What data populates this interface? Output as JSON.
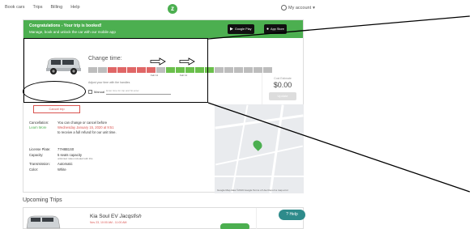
{
  "nav": {
    "links": [
      "Book cars",
      "Trips",
      "Billing",
      "Help"
    ],
    "account_label": "My account"
  },
  "banner": {
    "title": "Congratulations - Your trip is booked!",
    "subtitle": "Manage, book and unlock the car with our mobile app",
    "google_play": "Google Play",
    "app_store": "App Store"
  },
  "trip": {
    "change_time_title": "Change time:",
    "time_start": "Feb 11",
    "time_end": "Feb 11",
    "timeline_note": "Adjust your time with the handles",
    "manual_label": "Manual",
    "manual_placeholder": "Enter time for trip and hit enter",
    "cancel_label": "Cancel trip",
    "timeline_colors": [
      "#bdbdbd",
      "#bdbdbd",
      "#e06666",
      "#e06666",
      "#e06666",
      "#e06666",
      "#e06666",
      "#bdbdbd",
      "#6abf4b",
      "#6abf4b",
      "#6abf4b",
      "#6abf4b",
      "#6abf4b",
      "#bdbdbd",
      "#bdbdbd",
      "#bdbdbd",
      "#bdbdbd",
      "#bdbdbd",
      "#bdbdbd"
    ]
  },
  "cost": {
    "label": "Cost Estimate",
    "value": "$0.00",
    "update_label": "Update",
    "get_support": "Get Support"
  },
  "details": {
    "cancellation_label": "Cancellation:",
    "learn_more": "Learn More",
    "cancel_line1": "You can change or cancel before",
    "cancel_line2": "Wednesday January 15, 2020 at 9:51",
    "cancel_line3": "to receive a full refund for our unit time.",
    "license_label": "License Plate:",
    "license_value": "77H8B1S0",
    "capacity_label": "Capacity:",
    "capacity_value": "5 seats capacity",
    "capacity_sub": "unlimited miles included with this",
    "transmission_label": "Transmission:",
    "transmission_value": "Automatic",
    "color_label": "Color:",
    "color_value": "White"
  },
  "map": {
    "google_label": "Google",
    "map_data": "Map data ©2019 Google  Terms of Use  Report a map error"
  },
  "upcoming": {
    "heading": "Upcoming Trips",
    "car_title": "Kia Soul EV",
    "car_name": "Jacqsfish",
    "car_sub": "Nov 23, 10:00 AM - 11:00 AM"
  },
  "help": {
    "label": "Help"
  }
}
